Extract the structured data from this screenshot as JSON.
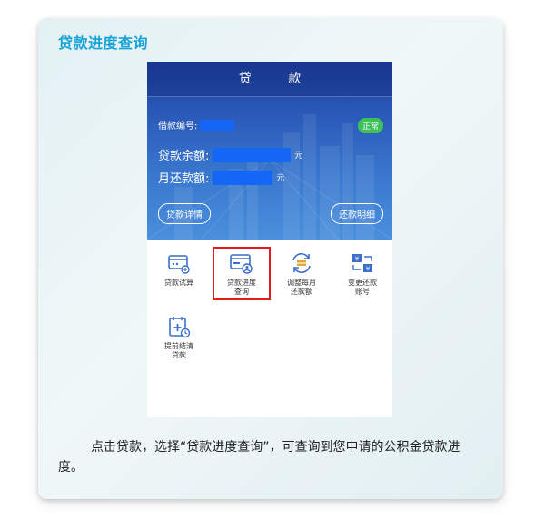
{
  "page": {
    "title": "贷款进度查询",
    "caption": "点击贷款，选择“贷款进度查询”，可查询到您申请的公积金贷款进度。"
  },
  "app": {
    "header_title": "贷 款",
    "loan_number_label": "借款编号:",
    "status_badge": "正常",
    "balance_label": "贷款余额:",
    "balance_unit": "元",
    "monthly_label": "月还款额:",
    "monthly_unit": "元",
    "details_button": "贷款详情",
    "repayment_button": "还款明细"
  },
  "menu": [
    {
      "label_line1": "贷款试算",
      "label_line2": "",
      "icon": "calculator-card-icon"
    },
    {
      "label_line1": "贷款进度",
      "label_line2": "查询",
      "icon": "progress-query-icon"
    },
    {
      "label_line1": "调整每月",
      "label_line2": "还款额",
      "icon": "adjust-payment-icon"
    },
    {
      "label_line1": "变更还款",
      "label_line2": "账号",
      "icon": "change-account-icon"
    },
    {
      "label_line1": "提前结清",
      "label_line2": "贷款",
      "icon": "early-settlement-icon"
    }
  ],
  "colors": {
    "title_accent": "#1aa3d6",
    "header_blue": "#2a5ab8",
    "mask_blue": "#1466f5",
    "badge_green": "#3dbf5a",
    "highlight_red": "#e31b1b",
    "icon_blue": "#3b6fc9"
  }
}
